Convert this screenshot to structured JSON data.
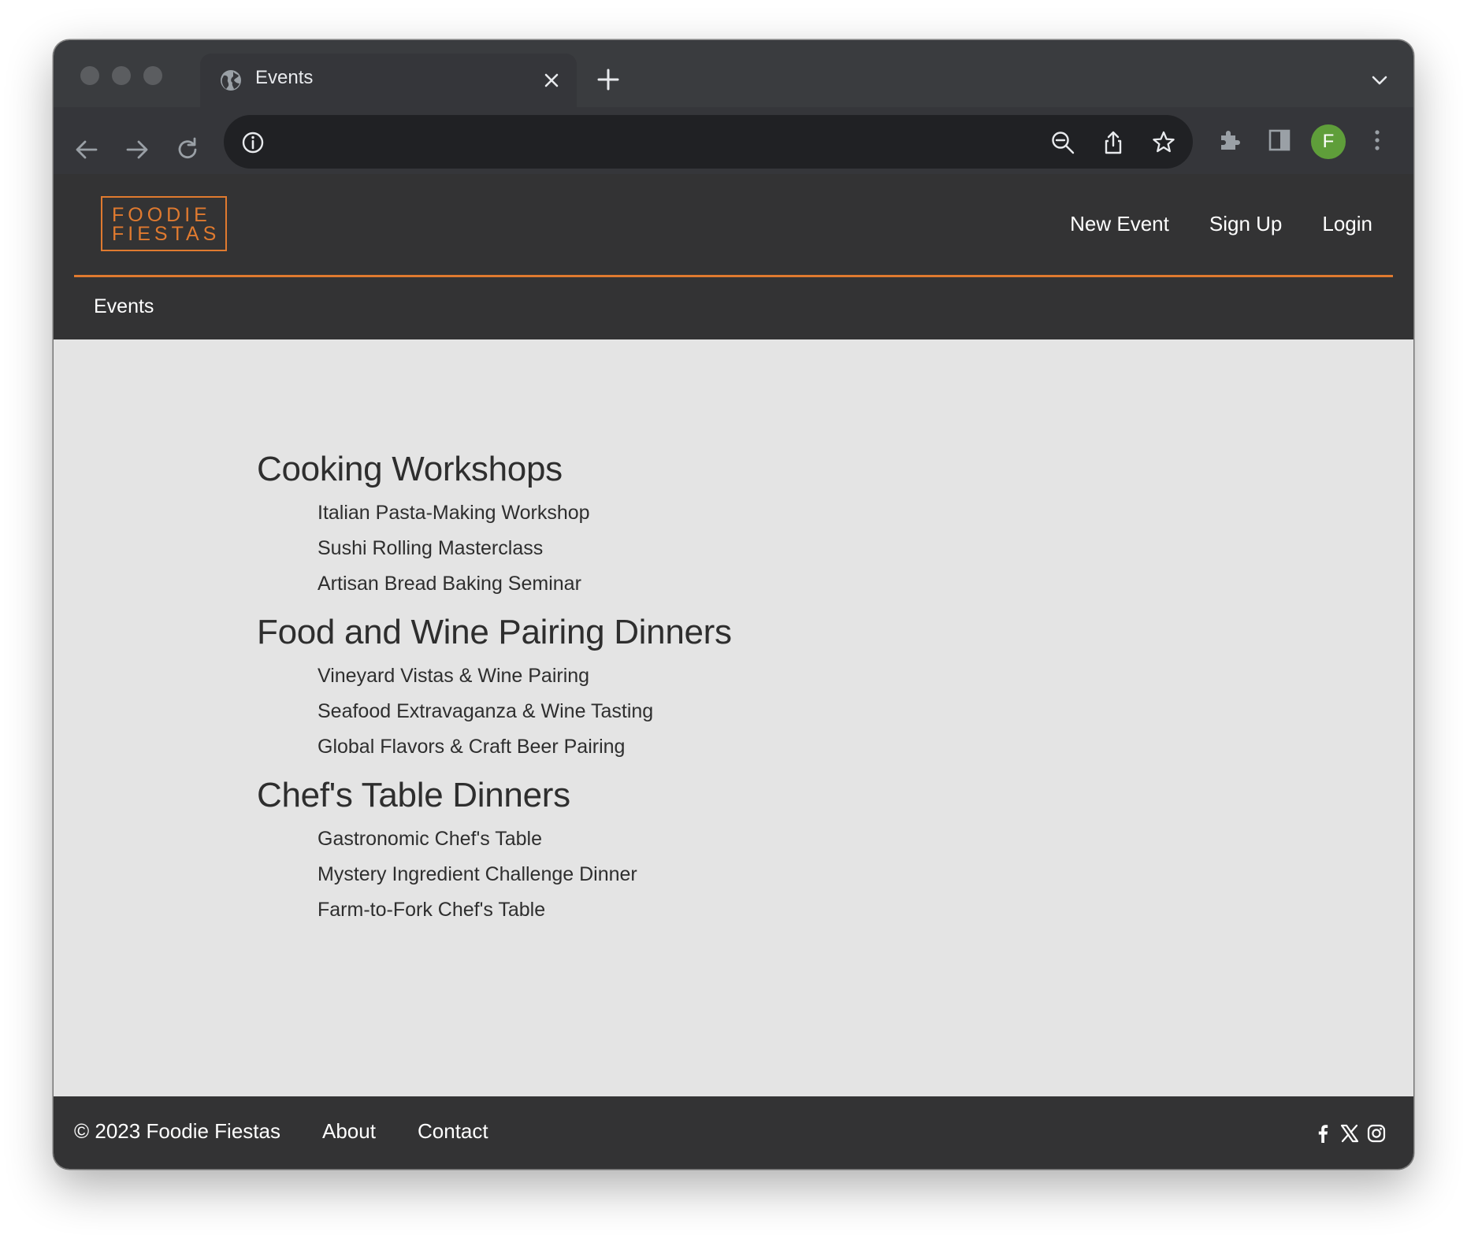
{
  "browser": {
    "tab_title": "Events",
    "profile_initial": "F"
  },
  "header": {
    "logo_line1": "FOODIE",
    "logo_line2": "FIESTAS",
    "nav": [
      "New Event",
      "Sign Up",
      "Login"
    ],
    "subnav": "Events",
    "accent_color": "#e07a2f"
  },
  "sections": [
    {
      "title": "Cooking Workshops",
      "items": [
        "Italian Pasta-Making Workshop",
        "Sushi Rolling Masterclass",
        "Artisan Bread Baking Seminar"
      ]
    },
    {
      "title": "Food and Wine Pairing Dinners",
      "items": [
        "Vineyard Vistas & Wine Pairing",
        "Seafood Extravaganza & Wine Tasting",
        "Global Flavors & Craft Beer Pairing"
      ]
    },
    {
      "title": "Chef's Table Dinners",
      "items": [
        "Gastronomic Chef's Table",
        "Mystery Ingredient Challenge Dinner",
        "Farm-to-Fork Chef's Table"
      ]
    }
  ],
  "footer": {
    "copyright": "© 2023 Foodie Fiestas",
    "links": [
      "About",
      "Contact"
    ],
    "social_icons": [
      "facebook-icon",
      "x-icon",
      "instagram-icon"
    ]
  }
}
